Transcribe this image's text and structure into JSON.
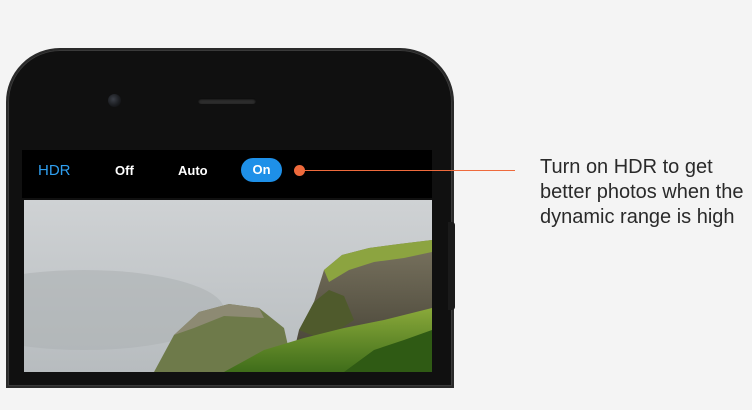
{
  "camera_bar": {
    "mode_label": "HDR",
    "options": [
      "Off",
      "Auto",
      "On"
    ],
    "selected": "On"
  },
  "callout": {
    "text": "Turn on HDR to get better photos when the dynamic range is high"
  },
  "colors": {
    "accent": "#1e90e8",
    "hdr_label": "#2f9ff0",
    "callout": "#ee6a3c",
    "background": "#f4f4f4"
  },
  "icons": {
    "front_camera": "front-camera-icon",
    "speaker": "earpiece-speaker-icon"
  }
}
